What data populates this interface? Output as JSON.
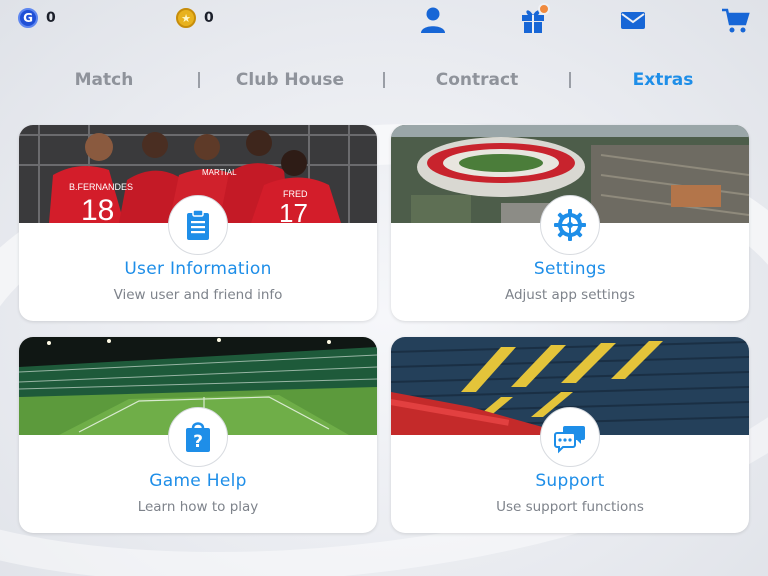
{
  "currencies": {
    "gp": {
      "symbol": "G",
      "amount": "0"
    },
    "coins": {
      "symbol": "★",
      "amount": "0"
    }
  },
  "top_icons": [
    "user-icon",
    "gift-icon",
    "mail-icon",
    "cart-icon"
  ],
  "tabs": [
    {
      "label": "Match",
      "active": false
    },
    {
      "label": "Club House",
      "active": false
    },
    {
      "label": "Contract",
      "active": false
    },
    {
      "label": "Extras",
      "active": true
    }
  ],
  "cards": [
    {
      "title": "User Information",
      "subtitle": "View user and friend info",
      "icon": "clipboard-icon",
      "banner_text": {
        "jersey_left_name": "B.FERNANDES",
        "jersey_left_number": "18",
        "jersey_mid_name": "MARTIAL",
        "jersey_right_name": "FRED",
        "jersey_right_number": "17"
      }
    },
    {
      "title": "Settings",
      "subtitle": "Adjust app settings",
      "icon": "gear-icon"
    },
    {
      "title": "Game Help",
      "subtitle": "Learn how to play",
      "icon": "help-bag-icon"
    },
    {
      "title": "Support",
      "subtitle": "Use support functions",
      "icon": "chat-bubbles-icon"
    }
  ],
  "colors": {
    "accent": "#1e8ee8",
    "inactive_tab": "#8f939b",
    "notification": "#f08a3e"
  }
}
